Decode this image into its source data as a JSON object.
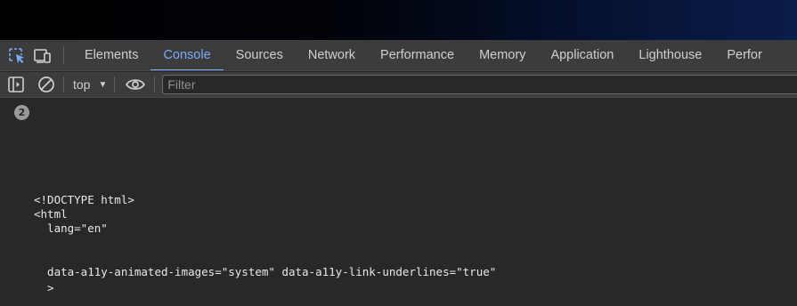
{
  "devtools": {
    "tabs": [
      {
        "label": "Elements",
        "active": false
      },
      {
        "label": "Console",
        "active": true
      },
      {
        "label": "Sources",
        "active": false
      },
      {
        "label": "Network",
        "active": false
      },
      {
        "label": "Performance",
        "active": false
      },
      {
        "label": "Memory",
        "active": false
      },
      {
        "label": "Application",
        "active": false
      },
      {
        "label": "Lighthouse",
        "active": false
      },
      {
        "label": "Perfor",
        "active": false
      }
    ],
    "icons": {
      "inspect": "inspect-element-icon",
      "device": "device-toolbar-icon",
      "sidebar": "sidebar-toggle-icon",
      "clear": "clear-console-icon",
      "eye": "live-expression-icon",
      "caret": "chevron-down-icon"
    },
    "accent_color": "#7cacf8"
  },
  "console_toolbar": {
    "context_label": "top",
    "filter_placeholder": "Filter",
    "filter_value": ""
  },
  "console": {
    "message_count": "2",
    "lines": [
      "<!DOCTYPE html>",
      "<html",
      "  lang=\"en\"",
      "  data-a11y-animated-images=\"system\" data-a11y-link-underlines=\"true\"",
      "  >"
    ]
  }
}
